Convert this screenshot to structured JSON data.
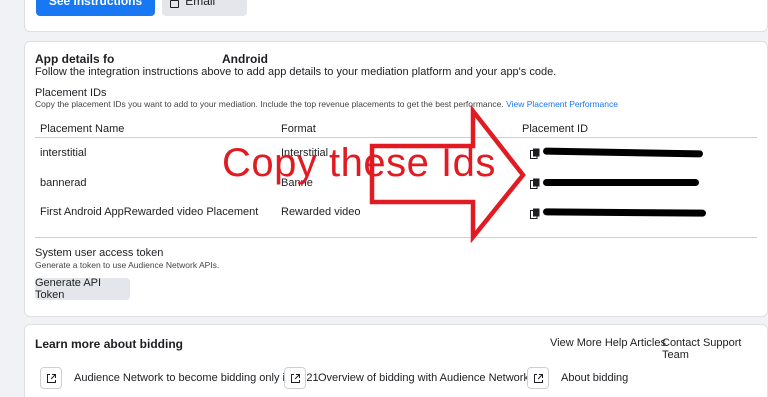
{
  "top_actions": {
    "see_instructions_label": "See Instructions",
    "send_email_label": "Send by Email"
  },
  "app_details": {
    "title": "App details fo",
    "platform": "Android",
    "description": "Follow the integration instructions above to add app details to your mediation platform and your app's code."
  },
  "placement_ids": {
    "label": "Placement IDs",
    "description": "Copy the placement IDs you want to add to your mediation. Include the top revenue placements to get the best performance.",
    "link": "View Placement Performance",
    "columns": [
      "Placement Name",
      "Format",
      "Placement ID"
    ],
    "rows": [
      {
        "name": "interstitial",
        "format": "Interstitial"
      },
      {
        "name": "bannerad",
        "format": "Banne"
      },
      {
        "name": "First Android AppRewarded video Placement",
        "format": "Rewarded video"
      }
    ]
  },
  "system_token": {
    "label": "System user access token",
    "description": "Generate a token to use Audience Network APIs.",
    "button": "Generate API Token"
  },
  "learn_more": {
    "title": "Learn more about bidding",
    "help_link": "View More Help Articles",
    "support_link": "Contact Support Team",
    "articles": [
      "Audience Network to become bidding only in 2021",
      "Overview of bidding with Audience Network",
      "About bidding"
    ]
  },
  "annotation": {
    "text": "Copy these Ids",
    "color": "#e21b23"
  }
}
